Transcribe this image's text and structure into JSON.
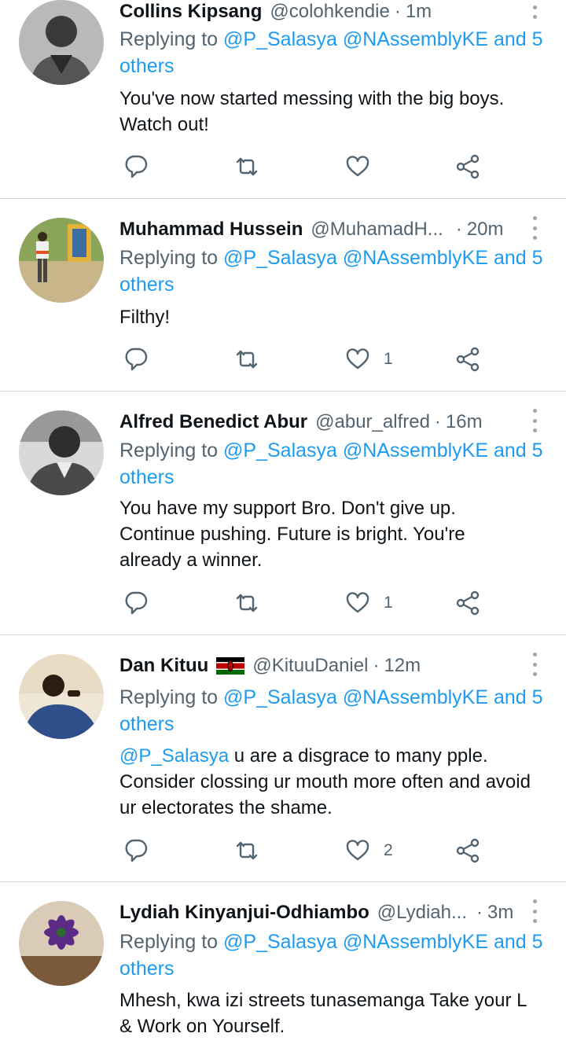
{
  "tweets": [
    {
      "name": "Collins Kipsang",
      "handle": "@colohkendie",
      "sep": "·",
      "time": "1m",
      "replying_prefix": "Replying to",
      "replying_line1_mentions": "@P_Salasya @NAssemblyKE and 5",
      "replying_line2": "others",
      "body_line1": "You've now started messing with the big boys.",
      "body_line2": "Watch out!",
      "like_count": ""
    },
    {
      "name": "Muhammad Hussein",
      "handle": "@MuhamadH...",
      "sep": "·",
      "time": "20m",
      "replying_prefix": "Replying to",
      "replying_line1_mentions": "@P_Salasya @NAssemblyKE and 5",
      "replying_line2": "others",
      "body_line1": "Filthy!",
      "like_count": "1"
    },
    {
      "name": "Alfred Benedict Abur",
      "handle": "@abur_alfred",
      "sep": "·",
      "time": "16m",
      "replying_prefix": "Replying to",
      "replying_line1_mentions": "@P_Salasya @NAssemblyKE and 5",
      "replying_line2": "others",
      "body_line1": "You have my support Bro. Don't give up.",
      "body_line2": "Continue pushing. Future is bright. You're",
      "body_line3": "already a winner.",
      "like_count": "1"
    },
    {
      "name": "Dan Kituu",
      "handle": "@KituuDaniel",
      "sep": "·",
      "time": "12m",
      "replying_prefix": "Replying to",
      "replying_line1_mentions": "@P_Salasya @NAssemblyKE and 5",
      "replying_line2": "others",
      "body_mention": "@P_Salasya",
      "body_line1_rest": " u are a disgrace to many pple.",
      "body_line2": "Consider clossing ur mouth more often and avoid",
      "body_line3": "ur electorates the shame.",
      "like_count": "2"
    },
    {
      "name": "Lydiah Kinyanjui-Odhiambo",
      "handle": "@Lydiah...",
      "sep": "·",
      "time": "3m",
      "replying_prefix": "Replying to",
      "replying_line1_mentions": "@P_Salasya @NAssemblyKE and 5",
      "replying_line2": "others",
      "body_line1": "Mhesh, kwa izi streets tunasemanga Take your L",
      "body_line2": "& Work on Yourself."
    }
  ],
  "icons": {
    "reply": "reply-icon",
    "retweet": "retweet-icon",
    "like": "heart-icon",
    "share": "share-icon",
    "more": "more-vertical-icon",
    "flag": "kenya-flag-icon"
  },
  "colors": {
    "link": "#1d9bf0",
    "secondary_text": "#536471",
    "divider": "#cfd9de"
  }
}
